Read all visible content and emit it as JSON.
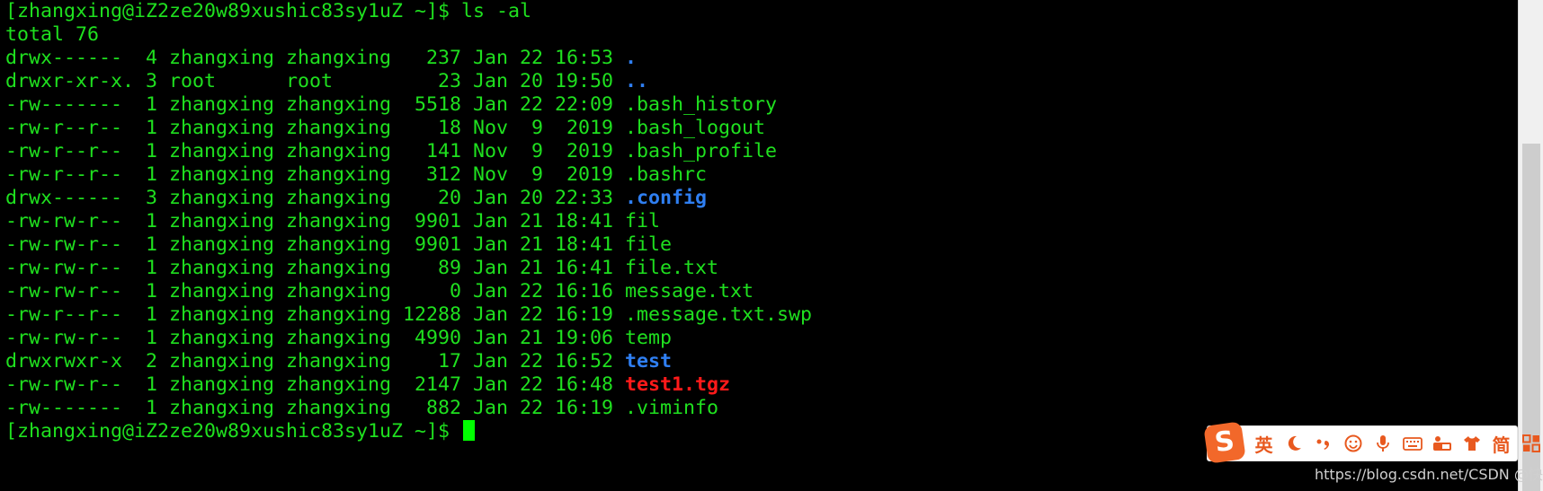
{
  "terminal": {
    "prompt": "[zhangxing@iZ2ze20w89xushic83sy1uZ ~]$ ",
    "command": "ls -al",
    "total_line": "total 76",
    "entries": [
      {
        "meta": "drwx------  4 zhangxing zhangxing   237 Jan 22 16:53 ",
        "name": ".",
        "kind": "dir"
      },
      {
        "meta": "drwxr-xr-x. 3 root      root         23 Jan 20 19:50 ",
        "name": "..",
        "kind": "dir"
      },
      {
        "meta": "-rw-------  1 zhangxing zhangxing  5518 Jan 22 22:09 ",
        "name": ".bash_history",
        "kind": "file"
      },
      {
        "meta": "-rw-r--r--  1 zhangxing zhangxing    18 Nov  9  2019 ",
        "name": ".bash_logout",
        "kind": "file"
      },
      {
        "meta": "-rw-r--r--  1 zhangxing zhangxing   141 Nov  9  2019 ",
        "name": ".bash_profile",
        "kind": "file"
      },
      {
        "meta": "-rw-r--r--  1 zhangxing zhangxing   312 Nov  9  2019 ",
        "name": ".bashrc",
        "kind": "file"
      },
      {
        "meta": "drwx------  3 zhangxing zhangxing    20 Jan 20 22:33 ",
        "name": ".config",
        "kind": "dir"
      },
      {
        "meta": "-rw-rw-r--  1 zhangxing zhangxing  9901 Jan 21 18:41 ",
        "name": "fil",
        "kind": "file"
      },
      {
        "meta": "-rw-rw-r--  1 zhangxing zhangxing  9901 Jan 21 18:41 ",
        "name": "file",
        "kind": "file"
      },
      {
        "meta": "-rw-rw-r--  1 zhangxing zhangxing    89 Jan 21 16:41 ",
        "name": "file.txt",
        "kind": "file"
      },
      {
        "meta": "-rw-rw-r--  1 zhangxing zhangxing     0 Jan 22 16:16 ",
        "name": "message.txt",
        "kind": "file"
      },
      {
        "meta": "-rw-r--r--  1 zhangxing zhangxing 12288 Jan 22 16:19 ",
        "name": ".message.txt.swp",
        "kind": "file"
      },
      {
        "meta": "-rw-rw-r--  1 zhangxing zhangxing  4990 Jan 21 19:06 ",
        "name": "temp",
        "kind": "file"
      },
      {
        "meta": "drwxrwxr-x  2 zhangxing zhangxing    17 Jan 22 16:52 ",
        "name": "test",
        "kind": "dir"
      },
      {
        "meta": "-rw-rw-r--  1 zhangxing zhangxing  2147 Jan 22 16:48 ",
        "name": "test1.tgz",
        "kind": "archive"
      },
      {
        "meta": "-rw-------  1 zhangxing zhangxing   882 Jan 22 16:19 ",
        "name": ".viminfo",
        "kind": "file"
      }
    ],
    "final_prompt": "[zhangxing@iZ2ze20w89xushic83sy1uZ ~]$ "
  },
  "colors": {
    "text": "#1fe01f",
    "directory": "#2f7ff2",
    "archive": "#ff1a1a",
    "cursor": "#00ff00",
    "ime_accent": "#e8591f"
  },
  "ime": {
    "logo": "S",
    "mode_label": "英",
    "simplified_label": "简",
    "icons": [
      "moon-icon",
      "punctuation-icon",
      "emoji-icon",
      "microphone-icon",
      "keyboard-icon",
      "toolbox-icon",
      "skin-shirt-icon",
      "grid-menu-icon"
    ]
  },
  "watermark": "https://blog.csdn.net/CSDN @快乐江湖"
}
